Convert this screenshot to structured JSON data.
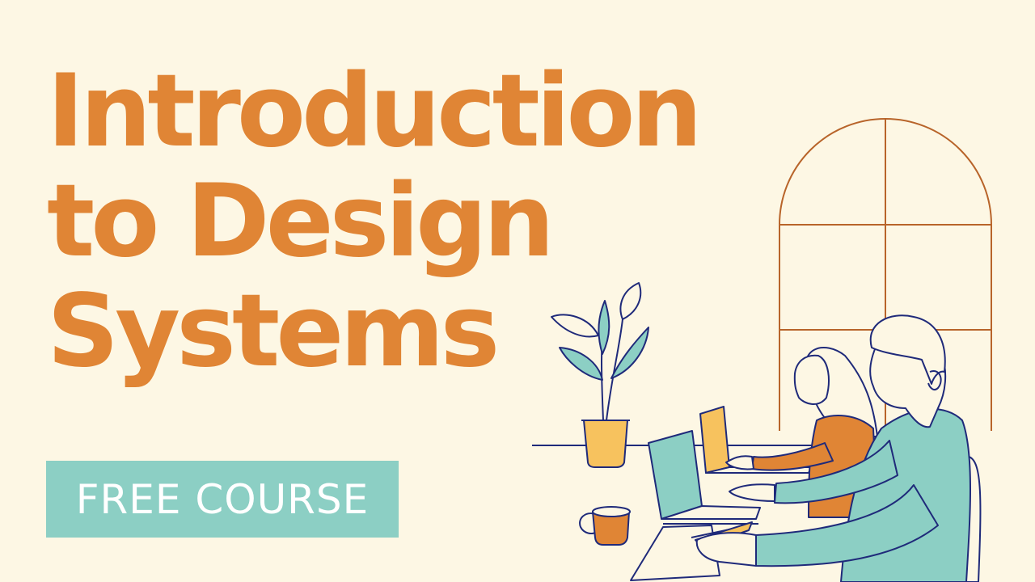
{
  "thumbnail": {
    "title_lines": [
      "Introduction",
      "to Design",
      "Systems"
    ],
    "badge_label": "FREE COURSE"
  },
  "colors": {
    "background": "#fdf7e4",
    "title": "#e08535",
    "badge": "#8ccfc4",
    "badge_text": "#ffffff",
    "outline": "#1f2a7a",
    "window_frame": "#b8642a",
    "teal_shirt": "#8ccfc4",
    "orange_sweater": "#e08535",
    "pot_yellow": "#f7c25e"
  },
  "icons": [
    "arched-window-icon",
    "potted-plant-icon",
    "laptop-icon",
    "coffee-mug-icon",
    "man-figure-icon",
    "woman-figure-icon"
  ]
}
